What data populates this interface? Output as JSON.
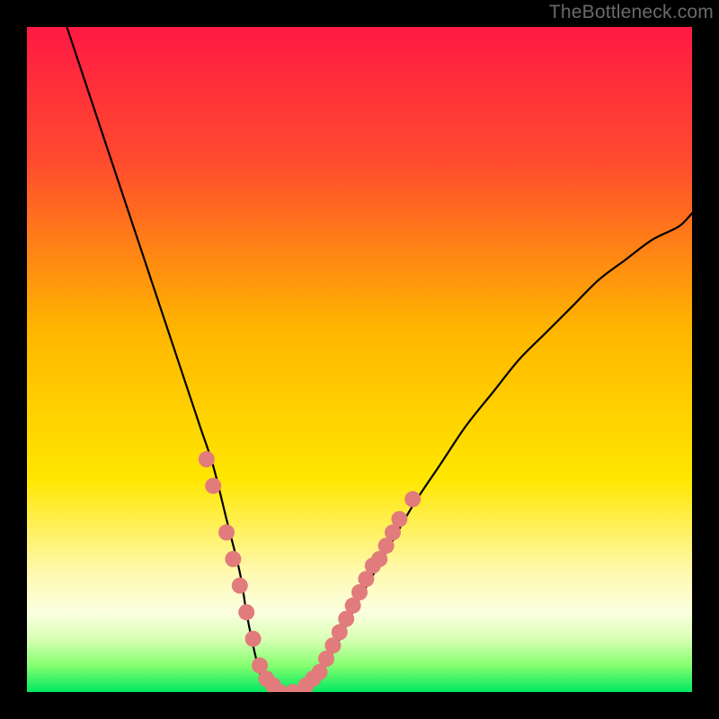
{
  "watermark": "TheBottleneck.com",
  "chart_data": {
    "type": "line",
    "title": "",
    "xlabel": "",
    "ylabel": "",
    "xlim": [
      0,
      100
    ],
    "ylim": [
      0,
      100
    ],
    "grid": false,
    "legend": false,
    "gradient_stops": [
      {
        "offset": 0.0,
        "color": "#ff1a44"
      },
      {
        "offset": 0.2,
        "color": "#ff4a2e"
      },
      {
        "offset": 0.45,
        "color": "#ffb400"
      },
      {
        "offset": 0.68,
        "color": "#ffe700"
      },
      {
        "offset": 0.82,
        "color": "#fff9b0"
      },
      {
        "offset": 0.88,
        "color": "#fbffe0"
      },
      {
        "offset": 0.92,
        "color": "#d9ffb5"
      },
      {
        "offset": 0.96,
        "color": "#86ff70"
      },
      {
        "offset": 1.0,
        "color": "#00e860"
      }
    ],
    "series": [
      {
        "name": "bottleneck-curve",
        "x": [
          6,
          8,
          10,
          12,
          14,
          16,
          18,
          20,
          22,
          24,
          26,
          28,
          30,
          32,
          33,
          34,
          35,
          36,
          38,
          40,
          42,
          44,
          46,
          48,
          50,
          54,
          58,
          62,
          66,
          70,
          74,
          78,
          82,
          86,
          90,
          94,
          98,
          100
        ],
        "y": [
          100,
          94,
          88,
          82,
          76,
          70,
          64,
          58,
          52,
          46,
          40,
          34,
          26,
          18,
          12,
          7,
          3,
          1,
          0,
          0,
          1,
          3,
          6,
          10,
          14,
          21,
          28,
          34,
          40,
          45,
          50,
          54,
          58,
          62,
          65,
          68,
          70,
          72
        ],
        "stroke": "#000000",
        "stroke_width": 2.2
      },
      {
        "name": "highlight-dots",
        "type": "scatter",
        "color": "#e27b7b",
        "radius": 9,
        "points": [
          {
            "x": 27,
            "y": 35
          },
          {
            "x": 28,
            "y": 31
          },
          {
            "x": 30,
            "y": 24
          },
          {
            "x": 31,
            "y": 20
          },
          {
            "x": 32,
            "y": 16
          },
          {
            "x": 33,
            "y": 12
          },
          {
            "x": 34,
            "y": 8
          },
          {
            "x": 35,
            "y": 4
          },
          {
            "x": 36,
            "y": 2
          },
          {
            "x": 37,
            "y": 1
          },
          {
            "x": 38,
            "y": 0
          },
          {
            "x": 40,
            "y": 0
          },
          {
            "x": 42,
            "y": 1
          },
          {
            "x": 43,
            "y": 2
          },
          {
            "x": 44,
            "y": 3
          },
          {
            "x": 45,
            "y": 5
          },
          {
            "x": 46,
            "y": 7
          },
          {
            "x": 47,
            "y": 9
          },
          {
            "x": 48,
            "y": 11
          },
          {
            "x": 49,
            "y": 13
          },
          {
            "x": 50,
            "y": 15
          },
          {
            "x": 51,
            "y": 17
          },
          {
            "x": 52,
            "y": 19
          },
          {
            "x": 53,
            "y": 20
          },
          {
            "x": 54,
            "y": 22
          },
          {
            "x": 55,
            "y": 24
          },
          {
            "x": 56,
            "y": 26
          },
          {
            "x": 58,
            "y": 29
          }
        ]
      }
    ]
  }
}
